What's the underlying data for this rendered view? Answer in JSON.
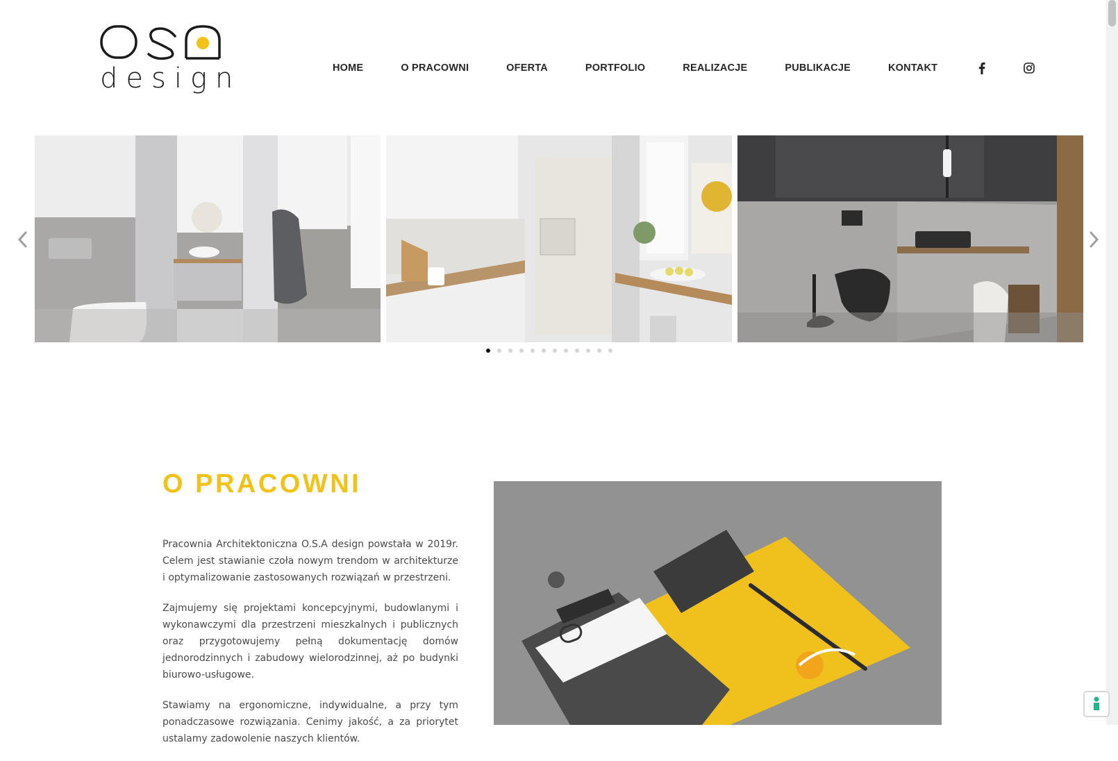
{
  "brand": {
    "logo_word": "design",
    "accent_color": "#f2c218",
    "text_color": "#222222"
  },
  "nav": {
    "items": [
      {
        "label": "HOME"
      },
      {
        "label": "O PRACOWNI"
      },
      {
        "label": "OFERTA"
      },
      {
        "label": "PORTFOLIO"
      },
      {
        "label": "REALIZACJE"
      },
      {
        "label": "PUBLIKACJE"
      },
      {
        "label": "KONTAKT"
      }
    ],
    "social": [
      {
        "icon": "facebook-icon"
      },
      {
        "icon": "instagram-icon"
      }
    ]
  },
  "slider": {
    "slides": [
      {
        "subject": "grey bathroom with terrazzo walls and towel"
      },
      {
        "subject": "white kitchen with wooden countertop and window"
      },
      {
        "subject": "dark bathroom with marble walls and black toilet"
      }
    ],
    "dot_count": 12,
    "active_dot": 1,
    "prev_icon": "chevron-left-icon",
    "next_icon": "chevron-right-icon"
  },
  "about": {
    "title": "O PRACOWNI",
    "paragraphs": [
      "Pracownia Architektoniczna O.S.A design powstała w 2019r. Celem jest stawianie czoła nowym trendom w architekturze i optymalizowanie zastosowanych rozwiązań w przestrzeni.",
      "Zajmujemy się projektami koncepcyjnymi, budowlanymi i wykonawczymi dla przestrzeni mieszkalnych i publicznych oraz przygotowujemy pełną dokumentację domów jednorodzinnych i zabudowy wielorodzinnej, aż po budynki biurowo-usługowe.",
      "Stawiamy na ergonomiczne, indywidualne, a przy tym ponadczasowe rozwiązania. Cenimy jakość, a za priorytet ustalamy zadowolenie naszych klientów."
    ]
  },
  "cookie_button": {
    "icon": "cookie-settings-icon"
  }
}
